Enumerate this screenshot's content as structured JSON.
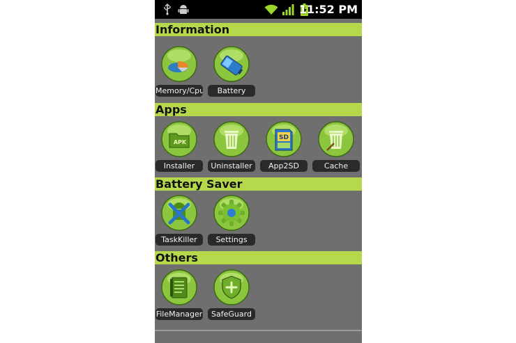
{
  "status_bar": {
    "time": "11:52 PM",
    "icons": [
      "usb-icon",
      "android-debug-icon",
      "wifi-icon",
      "signal-icon",
      "battery-charging-icon"
    ]
  },
  "sections": [
    {
      "title": "Information",
      "apps": [
        {
          "label": "Memory/Cpu",
          "icon": "memory-cpu-icon"
        },
        {
          "label": "Battery",
          "icon": "battery-icon"
        }
      ]
    },
    {
      "title": "Apps",
      "apps": [
        {
          "label": "Installer",
          "icon": "apk-installer-icon"
        },
        {
          "label": "Uninstaller",
          "icon": "trash-icon"
        },
        {
          "label": "App2SD",
          "icon": "sd-card-icon"
        },
        {
          "label": "Cache",
          "icon": "trash-broom-icon"
        }
      ]
    },
    {
      "title": "Battery Saver",
      "apps": [
        {
          "label": "TaskKiller",
          "icon": "task-killer-icon"
        },
        {
          "label": "Settings",
          "icon": "gear-icon"
        }
      ]
    },
    {
      "title": "Others",
      "apps": [
        {
          "label": "FileManager",
          "icon": "file-manager-icon"
        },
        {
          "label": "SafeGuard",
          "icon": "shield-icon"
        }
      ]
    }
  ],
  "colors": {
    "header_green": "#b6d94b",
    "body_gray": "#6f6f6f",
    "label_bg": "#2a2a2a",
    "icon_green": "#8cc63f"
  }
}
